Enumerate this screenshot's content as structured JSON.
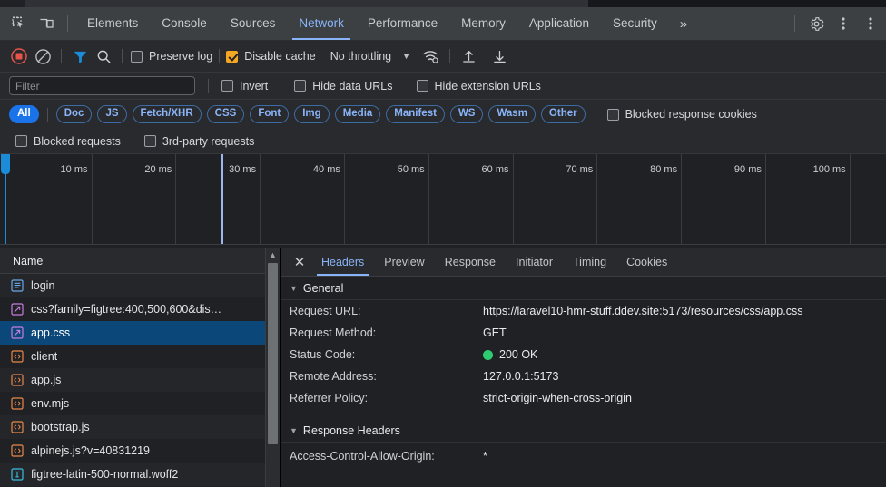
{
  "devtools": {
    "toolbar_icons": [
      {
        "name": "inspect-element-icon",
        "glyph": "inspect"
      },
      {
        "name": "device-toolbar-icon",
        "glyph": "device"
      }
    ],
    "tabs": [
      {
        "label": "Elements",
        "active": false
      },
      {
        "label": "Console",
        "active": false
      },
      {
        "label": "Sources",
        "active": false
      },
      {
        "label": "Network",
        "active": true
      },
      {
        "label": "Performance",
        "active": false
      },
      {
        "label": "Memory",
        "active": false
      },
      {
        "label": "Application",
        "active": false
      },
      {
        "label": "Security",
        "active": false
      }
    ],
    "more_tabs_label": "»",
    "settings_icon": "gear-icon",
    "more_options_icon": "kebab-menu-icon"
  },
  "network_toolbar": {
    "record_label": "record-stop-button",
    "clear_label": "clear-button",
    "filter_icon_label": "filter-icon",
    "search_icon_label": "search-icon",
    "preserve_log": {
      "label": "Preserve log",
      "checked": false
    },
    "disable_cache": {
      "label": "Disable cache",
      "checked": true
    },
    "throttling": {
      "value": "No throttling",
      "arrow": "▼"
    },
    "network_conditions_icon": "wifi-settings-icon",
    "import_icon": "import-har-icon",
    "export_icon": "export-har-icon"
  },
  "filter_bar": {
    "search": {
      "placeholder": "Filter",
      "value": ""
    },
    "invert": {
      "label": "Invert",
      "checked": false
    },
    "hide_data_urls": {
      "label": "Hide data URLs",
      "checked": false
    },
    "hide_extension_urls": {
      "label": "Hide extension URLs",
      "checked": false
    },
    "type_chips": [
      {
        "label": "All",
        "active": true
      },
      {
        "label": "Doc",
        "active": false
      },
      {
        "label": "JS",
        "active": false
      },
      {
        "label": "Fetch/XHR",
        "active": false
      },
      {
        "label": "CSS",
        "active": false
      },
      {
        "label": "Font",
        "active": false
      },
      {
        "label": "Img",
        "active": false
      },
      {
        "label": "Media",
        "active": false
      },
      {
        "label": "Manifest",
        "active": false
      },
      {
        "label": "WS",
        "active": false
      },
      {
        "label": "Wasm",
        "active": false
      },
      {
        "label": "Other",
        "active": false
      }
    ],
    "blocked_response_cookies": {
      "label": "Blocked response cookies",
      "checked": false
    },
    "blocked_requests": {
      "label": "Blocked requests",
      "checked": false
    },
    "third_party_requests": {
      "label": "3rd-party requests",
      "checked": false
    }
  },
  "overview": {
    "ticks": [
      "10 ms",
      "20 ms",
      "30 ms",
      "40 ms",
      "50 ms",
      "60 ms",
      "70 ms",
      "80 ms",
      "90 ms",
      "100 ms"
    ]
  },
  "request_list": {
    "column_header": "Name",
    "rows": [
      {
        "name": "login",
        "icon": "document-icon",
        "icon_type": "doc",
        "selected": false
      },
      {
        "name": "css?family=figtree:400,500,600&dis…",
        "icon": "stylesheet-icon",
        "icon_type": "css",
        "selected": false
      },
      {
        "name": "app.css",
        "icon": "stylesheet-icon",
        "icon_type": "css",
        "selected": true
      },
      {
        "name": "client",
        "icon": "script-icon",
        "icon_type": "js",
        "selected": false
      },
      {
        "name": "app.js",
        "icon": "script-icon",
        "icon_type": "js",
        "selected": false
      },
      {
        "name": "env.mjs",
        "icon": "script-icon",
        "icon_type": "js",
        "selected": false
      },
      {
        "name": "bootstrap.js",
        "icon": "script-icon",
        "icon_type": "js",
        "selected": false
      },
      {
        "name": "alpinejs.js?v=40831219",
        "icon": "script-icon",
        "icon_type": "js",
        "selected": false
      },
      {
        "name": "figtree-latin-500-normal.woff2",
        "icon": "font-icon",
        "icon_type": "font",
        "selected": false
      }
    ]
  },
  "detail_panel": {
    "close_label": "✕",
    "tabs": [
      {
        "label": "Headers",
        "active": true
      },
      {
        "label": "Preview",
        "active": false
      },
      {
        "label": "Response",
        "active": false
      },
      {
        "label": "Initiator",
        "active": false
      },
      {
        "label": "Timing",
        "active": false
      },
      {
        "label": "Cookies",
        "active": false
      }
    ],
    "general": {
      "title": "General",
      "items": [
        {
          "key": "Request URL:",
          "value": "https://laravel10-hmr-stuff.ddev.site:5173/resources/css/app.css"
        },
        {
          "key": "Request Method:",
          "value": "GET"
        },
        {
          "key": "Status Code:",
          "value": "200 OK",
          "status_dot": "#2ecc71"
        },
        {
          "key": "Remote Address:",
          "value": "127.0.0.1:5173"
        },
        {
          "key": "Referrer Policy:",
          "value": "strict-origin-when-cross-origin"
        }
      ]
    },
    "response_headers": {
      "title": "Response Headers",
      "items": [
        {
          "key": "Access-Control-Allow-Origin:",
          "value": "*"
        }
      ]
    }
  },
  "colors": {
    "accent_blue": "#8ab4f8",
    "chip_active": "#1a73e8",
    "selected_row": "#0b4778",
    "checkbox_on": "#f5a623",
    "status_ok": "#2ecc71"
  }
}
